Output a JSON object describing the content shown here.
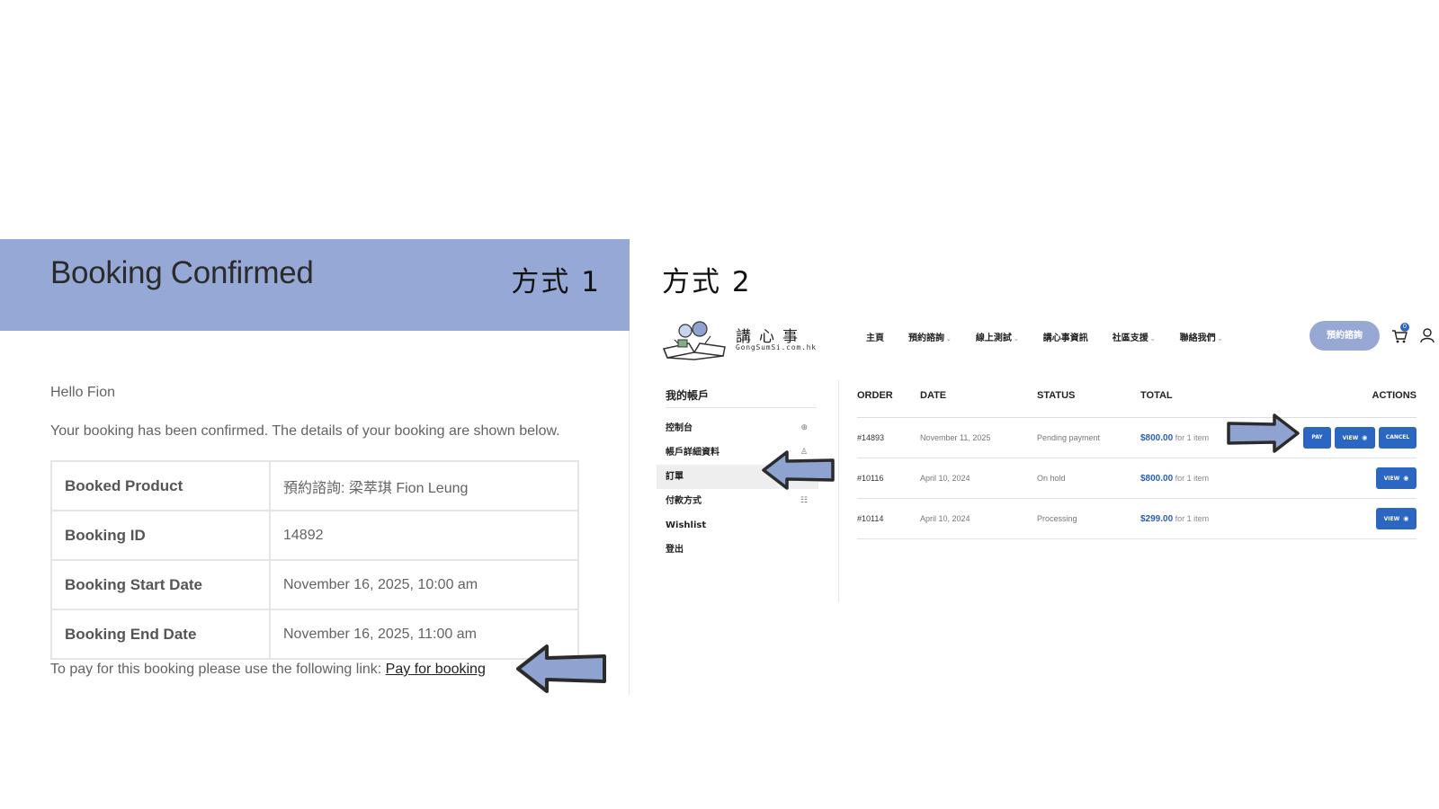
{
  "email": {
    "title": "Booking Confirmed",
    "method_label": "方式 1",
    "greeting": "Hello Fion",
    "intro": "Your booking has been confirmed. The details of your booking are shown below.",
    "rows": [
      {
        "label": "Booked Product",
        "value": "預約諮詢: 梁萃琪 Fion Leung"
      },
      {
        "label": "Booking ID",
        "value": "14892"
      },
      {
        "label": "Booking Start Date",
        "value": "November 16, 2025, 10:00 am"
      },
      {
        "label": "Booking End Date",
        "value": "November 16, 2025, 11:00 am"
      }
    ],
    "pay_prefix": "To pay for this booking please use the following link:",
    "pay_link": "Pay for booking"
  },
  "site": {
    "method_label": "方式 2",
    "logo": {
      "name": "講心事",
      "url": "GongSumSi.com.hk"
    },
    "nav": [
      {
        "label": "主頁",
        "has_dropdown": false
      },
      {
        "label": "預約諮詢",
        "has_dropdown": true
      },
      {
        "label": "線上測試",
        "has_dropdown": true
      },
      {
        "label": "講心事資訊",
        "has_dropdown": false
      },
      {
        "label": "社區支援",
        "has_dropdown": true
      },
      {
        "label": "聯絡我們",
        "has_dropdown": true
      }
    ],
    "cta_label": "預約諮詢",
    "cart_count": "0",
    "account": {
      "title": "我的帳戶",
      "items": [
        {
          "label": "控制台",
          "icon": "dashboard-icon",
          "glyph": "⊕"
        },
        {
          "label": "帳戶詳細資料",
          "icon": "user-icon",
          "glyph": "♙"
        },
        {
          "label": "訂單",
          "icon": "",
          "glyph": ""
        },
        {
          "label": "付款方式",
          "icon": "list-icon",
          "glyph": "☷"
        },
        {
          "label": "Wishlist",
          "icon": "",
          "glyph": ""
        },
        {
          "label": "登出",
          "icon": "",
          "glyph": ""
        }
      ],
      "active_index": 2
    },
    "orders": {
      "headers": {
        "order": "ORDER",
        "date": "DATE",
        "status": "STATUS",
        "total": "TOTAL",
        "actions": "ACTIONS"
      },
      "rows": [
        {
          "order": "#14893",
          "date": "November 11, 2025",
          "status": "Pending payment",
          "amount": "$800.00",
          "qty": "for 1 item",
          "actions": [
            "PAY",
            "VIEW",
            "CANCEL"
          ]
        },
        {
          "order": "#10116",
          "date": "April 10, 2024",
          "status": "On hold",
          "amount": "$800.00",
          "qty": "for 1 item",
          "actions": [
            "VIEW"
          ]
        },
        {
          "order": "#10114",
          "date": "April 10, 2024",
          "status": "Processing",
          "amount": "$299.00",
          "qty": "for 1 item",
          "actions": [
            "VIEW"
          ]
        }
      ]
    }
  },
  "colors": {
    "header_blue": "#96a9d6",
    "button_blue": "#2a66c2",
    "arrow_fill": "#8ea3cf",
    "arrow_outline": "#2b2b2b"
  }
}
